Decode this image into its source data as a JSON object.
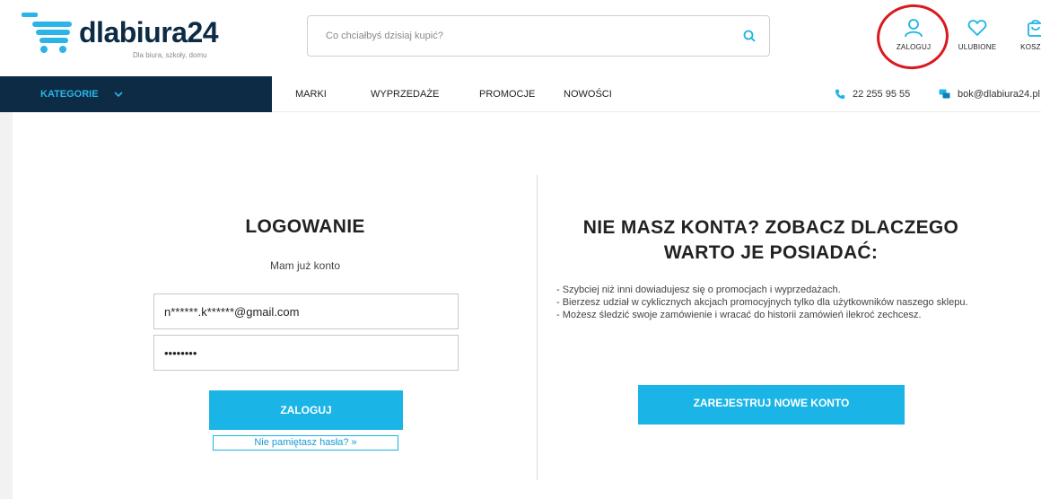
{
  "header": {
    "logo_text": "dlabiura24",
    "logo_tagline": "Dla biura, szkoły, domu",
    "search_placeholder": "Co chciałbyś dzisiaj kupić?",
    "actions": {
      "login": "ZALOGUJ",
      "favorites": "ULUBIONE",
      "cart": "KOSZYK"
    }
  },
  "nav": {
    "categories_label": "KATEGORIE",
    "links": [
      "MARKI",
      "WYPRZEDAŻE",
      "PROMOCJE",
      "NOWOŚCI"
    ],
    "phone": "22 255 95 55",
    "email": "bok@dlabiura24.pl"
  },
  "login": {
    "title": "LOGOWANIE",
    "subtitle": "Mam już konto",
    "email_value": "n******.k******@gmail.com",
    "password_value": "••••••••",
    "submit_label": "ZALOGUJ",
    "forgot_label": "Nie pamiętasz hasła? »"
  },
  "register": {
    "title": "NIE MASZ KONTA? ZOBACZ DLACZEGO WARTO JE POSIADAĆ:",
    "benefits": [
      "- Szybciej niż inni dowiadujesz się o promocjach i wyprzedażach.",
      "- Bierzesz udział w cyklicznych akcjach promocyjnych tylko dla użytkowników naszego sklepu.",
      "- Możesz śledzić swoje zamówienie i wracać do historii zamówień ilekroć zechcesz."
    ],
    "button_label": "ZAREJESTRUJ NOWE KONTO"
  },
  "colors": {
    "brand_navy": "#0d2b45",
    "accent_blue": "#1ab4e6",
    "annotation_red": "#d9181f"
  },
  "icons": [
    "cart-logo-icon",
    "search-icon",
    "user-icon",
    "heart-icon",
    "cart-icon",
    "chevron-down-icon",
    "phone-icon",
    "chat-icon"
  ]
}
